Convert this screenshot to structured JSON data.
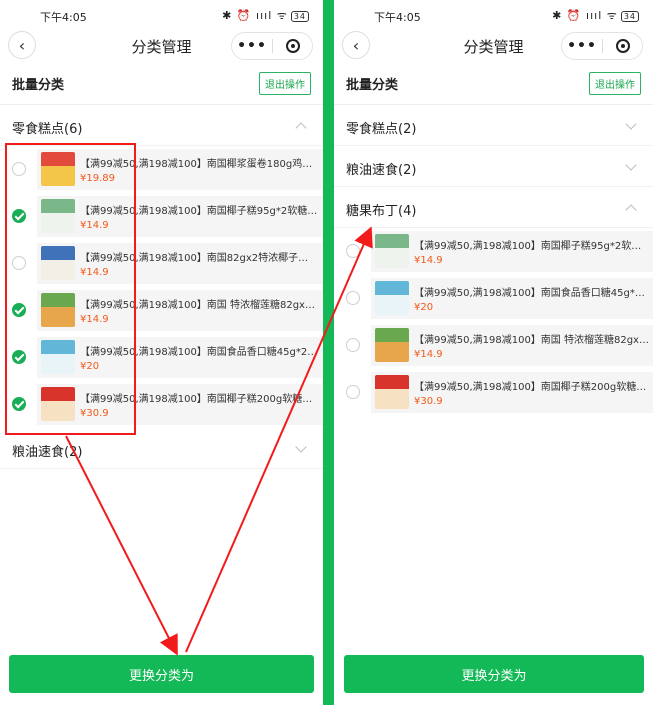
{
  "left": {
    "status": {
      "time": "下午4:05",
      "icons": "✱ ⏰ ıııl ᯤ",
      "battery": "34"
    },
    "nav": {
      "back": "‹",
      "title": "分类管理",
      "more": "•••"
    },
    "batch": {
      "title": "批量分类",
      "exit_label": "退出操作"
    },
    "categories": [
      {
        "name": "零食糕点(6)",
        "expanded": true,
        "items": [
          {
            "name": "【满99减50,满198减100】南国椰浆蛋卷180g鸡…",
            "price": "¥19.89",
            "checked": false,
            "thumb_top": "#e24b3b",
            "thumb_bottom": "#f3c64a"
          },
          {
            "name": "【满99减50,满198减100】南国椰子糕95g*2软糖…",
            "price": "¥14.9",
            "checked": true,
            "thumb_top": "#7ab88a",
            "thumb_bottom": "#eef3ee"
          },
          {
            "name": "【满99减50,满198减100】南国82gx2特浓椰子…",
            "price": "¥14.9",
            "checked": false,
            "thumb_top": "#3f72b8",
            "thumb_bottom": "#f2efe6"
          },
          {
            "name": "【满99减50,满198减100】南国 特浓榴莲糖82gx…",
            "price": "¥14.9",
            "checked": true,
            "thumb_top": "#6aa84f",
            "thumb_bottom": "#e8a64c"
          },
          {
            "name": "【满99减50,满198减100】南国食品香口糖45g*2…",
            "price": "¥20",
            "checked": true,
            "thumb_top": "#62b6d8",
            "thumb_bottom": "#e9f4f8"
          },
          {
            "name": "【满99减50,满198减100】南国椰子糕200g软糖…",
            "price": "¥30.9",
            "checked": true,
            "thumb_top": "#d9342b",
            "thumb_bottom": "#f6e2c3"
          }
        ]
      },
      {
        "name": "粮油速食(2)",
        "expanded": false,
        "items": []
      }
    ],
    "bottom_label": "更换分类为"
  },
  "right": {
    "status": {
      "time": "下午4:05",
      "icons": "✱ ⏰ ıııl ᯤ",
      "battery": "34"
    },
    "nav": {
      "back": "‹",
      "title": "分类管理",
      "more": "•••"
    },
    "batch": {
      "title": "批量分类",
      "exit_label": "退出操作"
    },
    "categories": [
      {
        "name": "零食糕点(2)",
        "expanded": false,
        "items": []
      },
      {
        "name": "粮油速食(2)",
        "expanded": false,
        "items": []
      },
      {
        "name": "糖果布丁(4)",
        "expanded": true,
        "items": [
          {
            "name": "【满99减50,满198减100】南国椰子糕95g*2软糖…",
            "price": "¥14.9",
            "checked": false,
            "thumb_top": "#7ab88a",
            "thumb_bottom": "#eef3ee"
          },
          {
            "name": "【满99减50,满198减100】南国食品香口糖45g*2…",
            "price": "¥20",
            "checked": false,
            "thumb_top": "#62b6d8",
            "thumb_bottom": "#e9f4f8"
          },
          {
            "name": "【满99减50,满198减100】南国 特浓榴莲糖82gx…",
            "price": "¥14.9",
            "checked": false,
            "thumb_top": "#6aa84f",
            "thumb_bottom": "#e8a64c"
          },
          {
            "name": "【满99减50,满198减100】南国椰子糕200g软糖…",
            "price": "¥30.9",
            "checked": false,
            "thumb_top": "#d9342b",
            "thumb_bottom": "#f6e2c3"
          }
        ]
      }
    ],
    "bottom_label": "更换分类为"
  },
  "colors": {
    "brand_green": "#12b956",
    "price_orange": "#f05a1a",
    "annotation_red": "#f21b1b"
  }
}
